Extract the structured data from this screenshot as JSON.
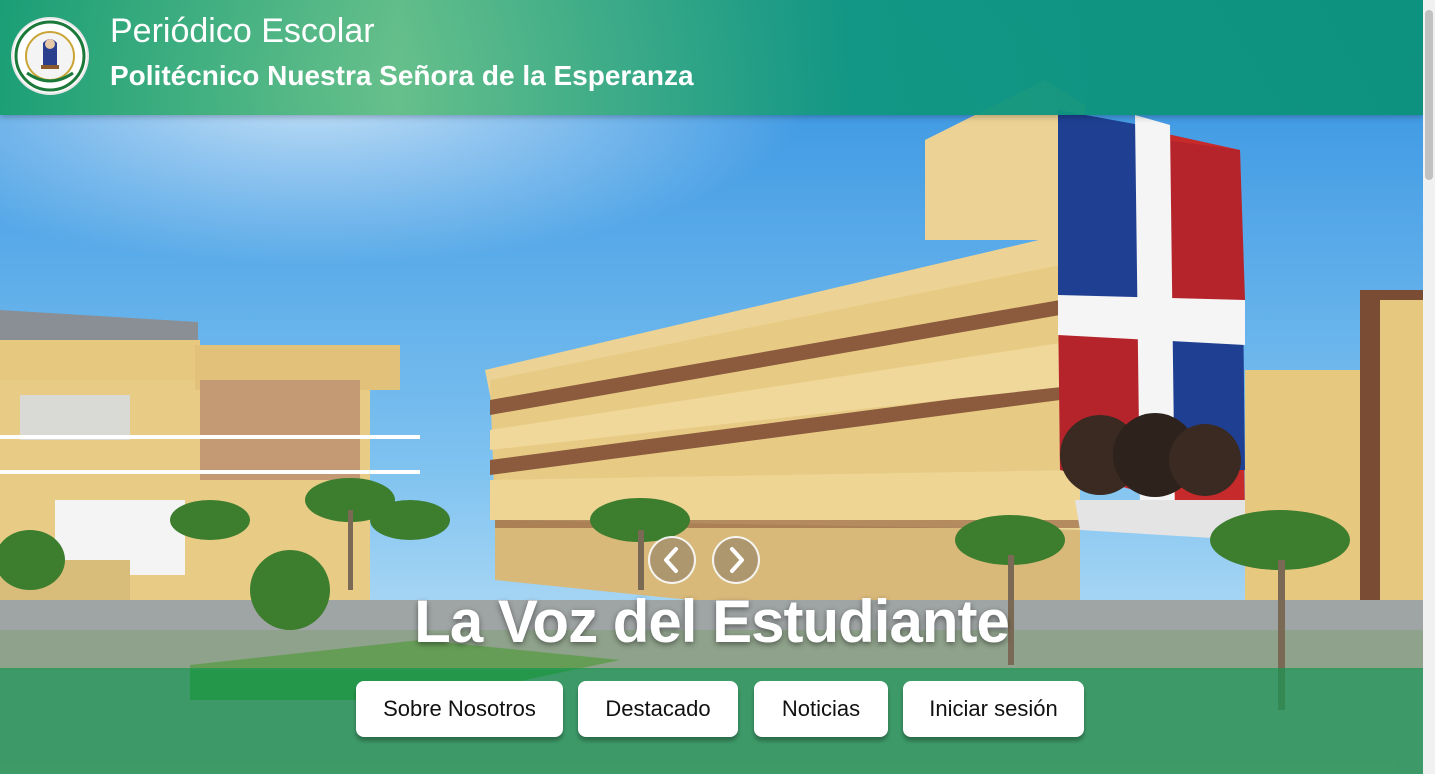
{
  "header": {
    "title": "Periódico Escolar",
    "subtitle": "Politécnico Nuestra Señora de la Esperanza",
    "logo_icon": "school-crest-logo"
  },
  "hero": {
    "headline": "La Voz del Estudiante",
    "prev_icon": "chevron-left-icon",
    "next_icon": "chevron-right-icon"
  },
  "nav": {
    "items": [
      {
        "label": "Sobre Nosotros"
      },
      {
        "label": "Destacado"
      },
      {
        "label": "Noticias"
      },
      {
        "label": "Iniciar sesión"
      }
    ]
  },
  "colors": {
    "header_green": "#12967c",
    "nav_band_green": "#189650",
    "sky": "#3e9be6",
    "building_yellow": "#e9cf8d"
  }
}
